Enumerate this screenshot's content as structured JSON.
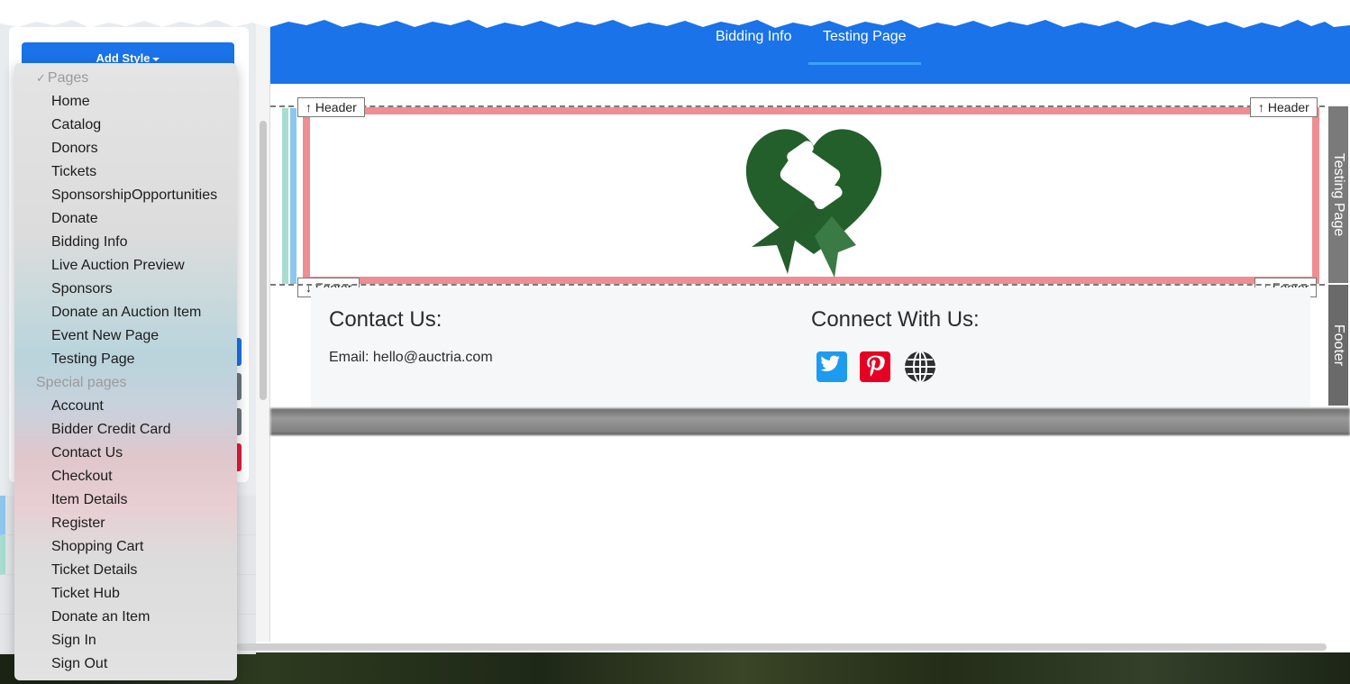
{
  "toolbar": {
    "add_style_label": "Add Style"
  },
  "dropdown": {
    "pages_header": "Pages",
    "pages_check": "✓",
    "pages": [
      "Home",
      "Catalog",
      "Donors",
      "Tickets",
      "SponsorshipOpportunities",
      "Donate",
      "Bidding Info",
      "Live Auction Preview",
      "Sponsors",
      "Donate an Auction Item",
      "Event New Page",
      "Testing Page"
    ],
    "special_header": "Special pages",
    "special_pages": [
      "Account",
      "Bidder Credit Card",
      "Contact Us",
      "Checkout",
      "Item Details",
      "Register",
      "Shopping Cart",
      "Ticket Details",
      "Ticket Hub",
      "Donate an Item",
      "Sign In",
      "Sign Out"
    ]
  },
  "nav": {
    "bidding_info": "Bidding Info",
    "testing_page": "Testing Page"
  },
  "section_tags": {
    "header_up": "Header",
    "footer_down": "Footer"
  },
  "side_labels": {
    "testing_page": "Testing Page",
    "footer": "Footer"
  },
  "footer": {
    "contact_title": "Contact Us:",
    "contact_email": "Email: hello@auctria.com",
    "connect_title": "Connect With Us:"
  },
  "icons": {
    "twitter": "twitter-icon",
    "pinterest": "pinterest-icon",
    "globe": "globe-icon",
    "logo": "heart-gavel-logo"
  },
  "colors": {
    "primary": "#1a73e8",
    "header_frame": "#ee8d92",
    "logo_green": "#245c2b",
    "twitter": "#1d9bf0",
    "pinterest": "#e60023"
  }
}
